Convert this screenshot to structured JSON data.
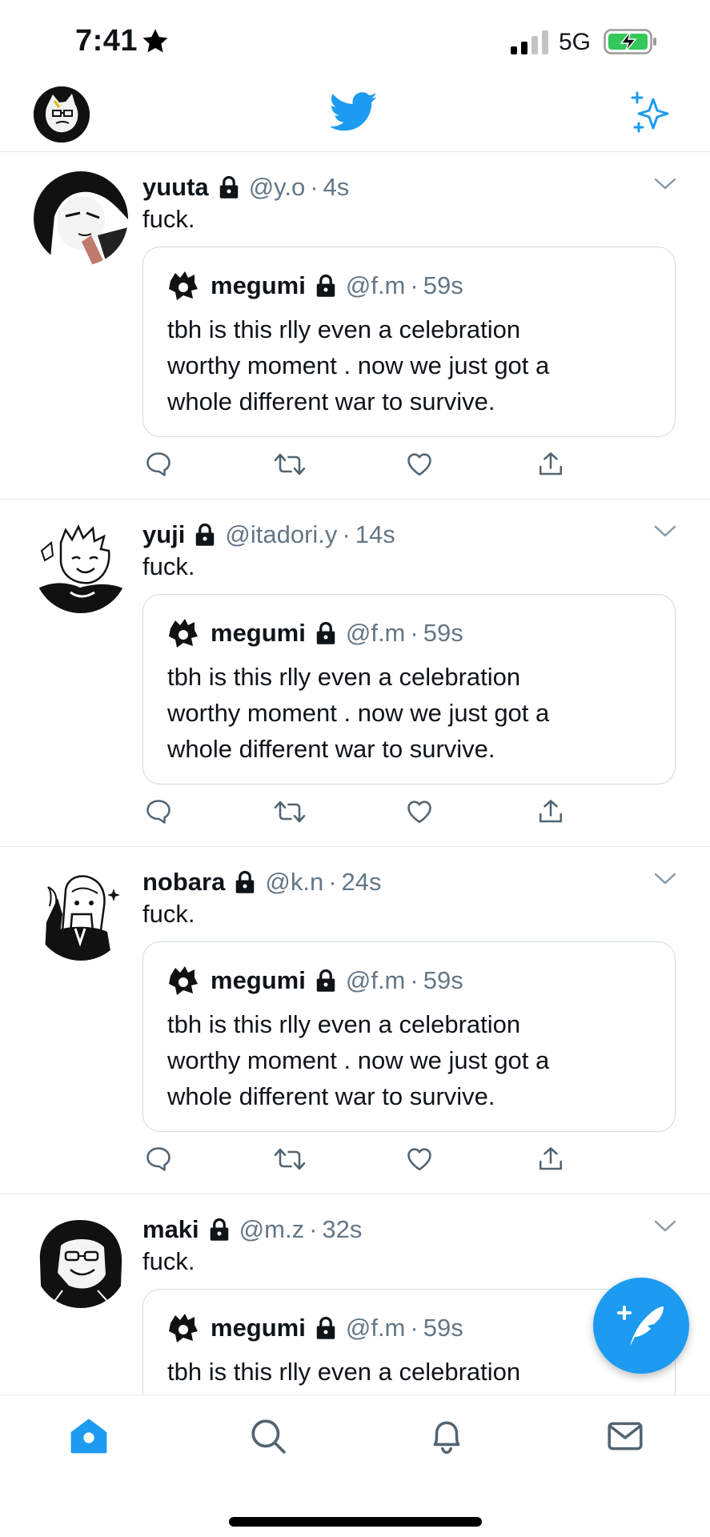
{
  "status_bar": {
    "time": "7:41",
    "network": "5G",
    "signal_bars_active": 2,
    "signal_bars_total": 4,
    "battery": "charging"
  },
  "top_nav": {
    "center_icon": "twitter-bird-icon",
    "right_icon": "sparkle-icon",
    "colors": {
      "accent": "#1d9bf0"
    }
  },
  "quoted_tweet": {
    "name": "megumi",
    "handle": "@f.m",
    "time": "59s",
    "text_lines": [
      "tbh is this rlly even a celebration",
      "worthy moment . now we just got a",
      "whole different war to survive."
    ]
  },
  "tweets": [
    {
      "name": "yuuta",
      "handle": "@y.o",
      "time": "4s",
      "text": "fuck."
    },
    {
      "name": "yuji",
      "handle": "@itadori.y",
      "time": "14s",
      "text": "fuck."
    },
    {
      "name": "nobara",
      "handle": "@k.n",
      "time": "24s",
      "text": "fuck."
    },
    {
      "name": "maki",
      "handle": "@m.z",
      "time": "32s",
      "text": "fuck."
    }
  ],
  "separator": "·",
  "bottom_nav": [
    "home-icon",
    "search-icon",
    "bell-icon",
    "mail-icon"
  ]
}
